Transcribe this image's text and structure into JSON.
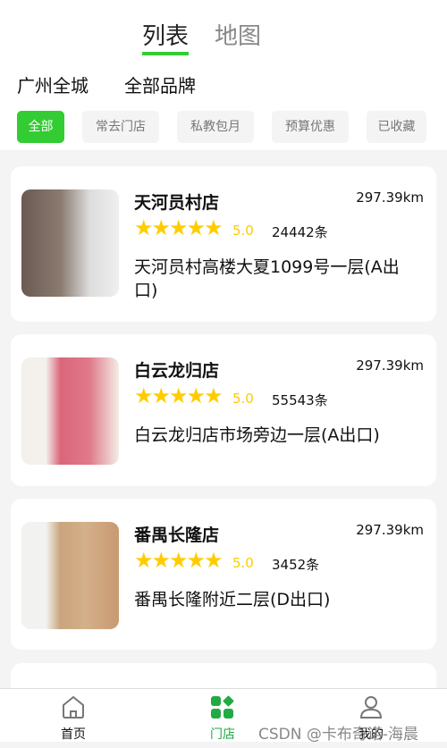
{
  "tabs": [
    "列表",
    "地图"
  ],
  "filters": [
    "广州全城",
    "全部品牌"
  ],
  "chips": [
    "全部",
    "常去门店",
    "私教包月",
    "预算优惠",
    "已收藏"
  ],
  "stores": [
    {
      "name": "天河员村店",
      "distance": "297.39km",
      "stars": "★★★★★",
      "score": "5.0",
      "count": "24442条",
      "address": "天河员村高楼大夏1099号一层(A出口)"
    },
    {
      "name": "白云龙归店",
      "distance": "297.39km",
      "stars": "★★★★★",
      "score": "5.0",
      "count": "55543条",
      "address": "白云龙归店市场旁边一层(A出口)"
    },
    {
      "name": "番禺长隆店",
      "distance": "297.39km",
      "stars": "★★★★★",
      "score": "5.0",
      "count": "3452条",
      "address": "番禺长隆附近二层(D出口)"
    }
  ],
  "tabbar": [
    "首页",
    "门店",
    "我的"
  ],
  "watermark": "CSDN @卡布奇诺-海晨",
  "colors": {
    "accent": "#33cc33",
    "star": "#ffcc00",
    "tab_active": "#22aa44"
  }
}
